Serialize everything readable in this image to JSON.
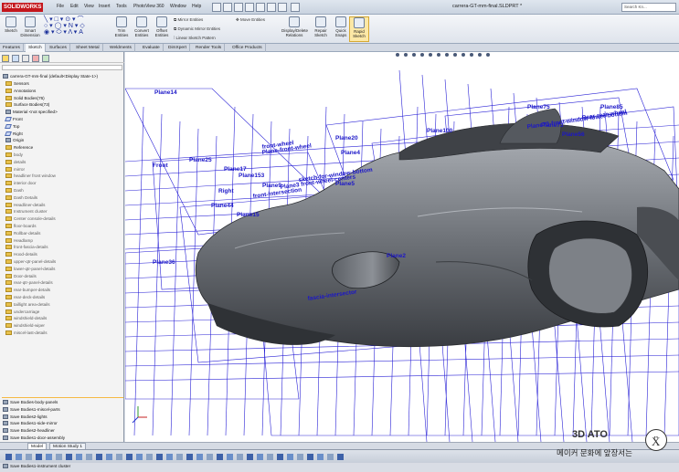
{
  "app": {
    "logo_text": "SOLIDWORKS",
    "document_title": "carrera-GT-mm-final.SLDPRT *",
    "search_placeholder": "Search Kn..."
  },
  "menu": [
    "File",
    "Edit",
    "View",
    "Insert",
    "Tools",
    "PhotoView 360",
    "Window",
    "Help"
  ],
  "ribbon": {
    "sketch": "Sketch",
    "smart_dimension": "Smart Dimension",
    "trim_entities": "Trim Entities",
    "convert_entities": "Convert Entities",
    "offset_entities": "Offset Entities",
    "mirror_entities": "Mirror Entities",
    "dynamic_mirror": "Dynamic Mirror Entities",
    "linear_pattern": "Linear Sketch Pattern",
    "move_entities": "Move Entities",
    "display_delete": "Display/Delete Relations",
    "repair_sketch": "Repair Sketch",
    "quick_snaps": "Quick Snaps",
    "rapid_sketch": "Rapid Sketch"
  },
  "tabs": [
    "Features",
    "Sketch",
    "Surfaces",
    "Sheet Metal",
    "Weldments",
    "Evaluate",
    "DimXpert",
    "Render Tools",
    "Office Products"
  ],
  "active_tab": "Sketch",
  "tree": {
    "root": "carrera-GT-mm-final (default<Display State-1>)",
    "items": [
      {
        "label": "Sensors",
        "kind": "folder"
      },
      {
        "label": "Annotations",
        "kind": "folder"
      },
      {
        "label": "Solid Bodies(76)",
        "kind": "folder"
      },
      {
        "label": "Surface Bodies(73)",
        "kind": "folder"
      },
      {
        "label": "Material <not specified>",
        "kind": "material"
      },
      {
        "label": "Front",
        "kind": "plane"
      },
      {
        "label": "Top",
        "kind": "plane"
      },
      {
        "label": "Right",
        "kind": "plane"
      },
      {
        "label": "Origin",
        "kind": "origin"
      },
      {
        "label": "Reference",
        "kind": "folder"
      },
      {
        "label": "body",
        "kind": "folder"
      },
      {
        "label": "details",
        "kind": "folder"
      },
      {
        "label": "mirror",
        "kind": "folder"
      },
      {
        "label": "headliner front window",
        "kind": "folder"
      },
      {
        "label": "interior door",
        "kind": "folder"
      },
      {
        "label": "Dash",
        "kind": "folder"
      },
      {
        "label": "Dash Details",
        "kind": "folder"
      },
      {
        "label": "Headliner-details",
        "kind": "folder"
      },
      {
        "label": "Instrument cluster",
        "kind": "folder"
      },
      {
        "label": "Center console-details",
        "kind": "folder"
      },
      {
        "label": "floor-boards",
        "kind": "folder"
      },
      {
        "label": "Rollbar-details",
        "kind": "folder"
      },
      {
        "label": "Headlamp",
        "kind": "folder"
      },
      {
        "label": "front-fascia-details",
        "kind": "folder"
      },
      {
        "label": "Hood-details",
        "kind": "folder"
      },
      {
        "label": "upper-qtr-panel-details",
        "kind": "folder"
      },
      {
        "label": "lower-qtr-panel-details",
        "kind": "folder"
      },
      {
        "label": "Door-details",
        "kind": "folder"
      },
      {
        "label": "rear-qtr-panel-details",
        "kind": "folder"
      },
      {
        "label": "rear-bumper-details",
        "kind": "folder"
      },
      {
        "label": "rear-deck-details",
        "kind": "folder"
      },
      {
        "label": "taillight area-details",
        "kind": "folder"
      },
      {
        "label": "undercarriage",
        "kind": "folder"
      },
      {
        "label": "windshield-details",
        "kind": "folder"
      },
      {
        "label": "windshield-wiper",
        "kind": "folder"
      },
      {
        "label": "miscel-last-details",
        "kind": "folder"
      }
    ],
    "saves": [
      "Save Bodies-body-panels",
      "Save Bodies1-miscel-parts",
      "Save Bodies2-lights",
      "Save Bodies1-side-mirror",
      "Save Bodies2-headliner",
      "Save Bodies1-door-assembly",
      "Save Bodies1-floorboard",
      "Save Bodies2-center console",
      "Save Bodies3-dash",
      "Save Bodies1-instrument cluster"
    ]
  },
  "bottom_tabs": [
    "Model",
    "Motion Study 1"
  ],
  "viewport": {
    "planes": [
      "Plane14",
      "Plane75",
      "Plane85",
      "Plane56",
      "Plane20",
      "Plane25",
      "Plane17",
      "Plane153",
      "Plane9",
      "Plane44",
      "Plane15",
      "Plane2",
      "Plane36",
      "Plane100",
      "Plane73",
      "Front",
      "Right",
      "Plane5",
      "Plane4"
    ],
    "annotations": [
      "Rear-rear-wheel",
      "Plane-front-wheel",
      "front-wheel",
      "Plane73-front-window-lower-bottom",
      "Plane3 front-wheel-centers",
      "sketch-for-window-bottom",
      "front-intersection",
      "fascia-intersector"
    ]
  },
  "watermark": {
    "brand": "3D ATO",
    "tagline": "메이커 문화에 앞장서는"
  },
  "colors": {
    "sketch_blue": "#2a22d6",
    "car_body": "#6f7378"
  }
}
